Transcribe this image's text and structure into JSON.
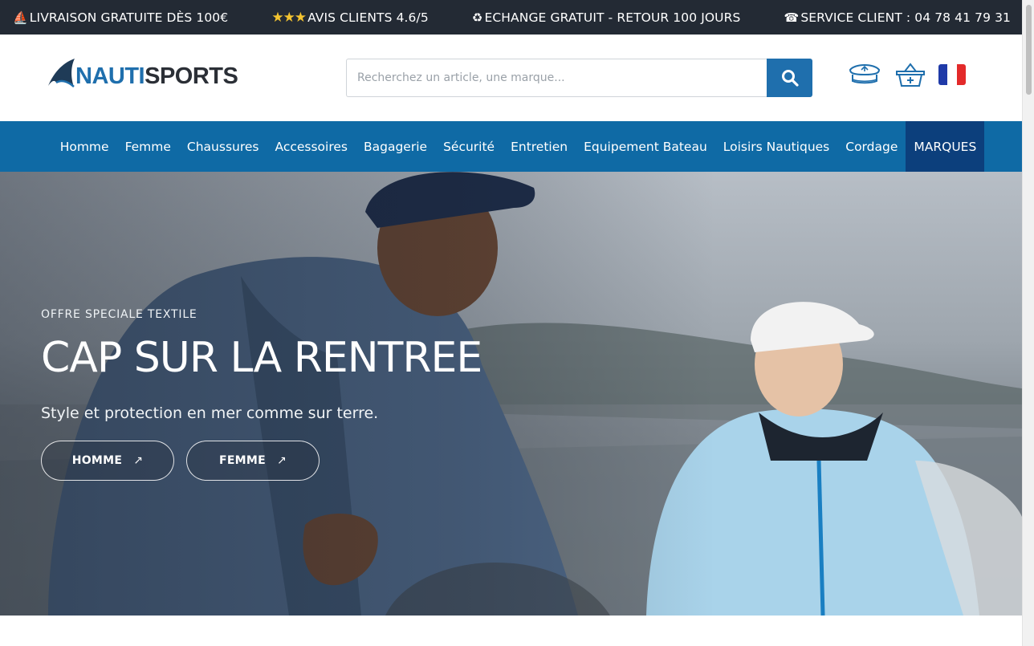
{
  "topbar": {
    "items": [
      {
        "icon": "sailboat-icon",
        "glyph": "⛵",
        "text": "LIVRAISON GRATUITE DÈS 100€"
      },
      {
        "icon": "stars-icon",
        "glyph": "★★★",
        "text": "AVIS CLIENTS 4.6/5"
      },
      {
        "icon": "recycle-icon",
        "glyph": "♻",
        "text": "ECHANGE GRATUIT - RETOUR 100 JOURS"
      },
      {
        "icon": "phone-icon",
        "glyph": "☎",
        "text": "SERVICE CLIENT : 04 78 41 79 31"
      }
    ]
  },
  "header": {
    "logo": {
      "part1": "NAUTI",
      "part2": "SPORTS"
    },
    "search": {
      "placeholder": "Recherchez un article, une marque..."
    },
    "icons": [
      "captain-hat-account-icon",
      "basket-cart-icon",
      "french-flag-icon"
    ]
  },
  "nav": {
    "items": [
      "Homme",
      "Femme",
      "Chaussures",
      "Accessoires",
      "Bagagerie",
      "Sécurité",
      "Entretien",
      "Equipement Bateau",
      "Loisirs Nautiques",
      "Cordage",
      "MARQUES"
    ]
  },
  "hero": {
    "eyebrow": "OFFRE SPECIALE TEXTILE",
    "title": "CAP SUR LA RENTREE",
    "subtitle": "Style et protection en mer comme sur terre.",
    "buttons": [
      {
        "label": "HOMME",
        "arrow": "↗"
      },
      {
        "label": "FEMME",
        "arrow": "↗"
      }
    ]
  },
  "colors": {
    "topbar_bg": "#232a34",
    "nav_bg": "#0f6aa5",
    "nav_active_bg": "#0c3f7c",
    "brand_blue": "#1f6fad"
  }
}
